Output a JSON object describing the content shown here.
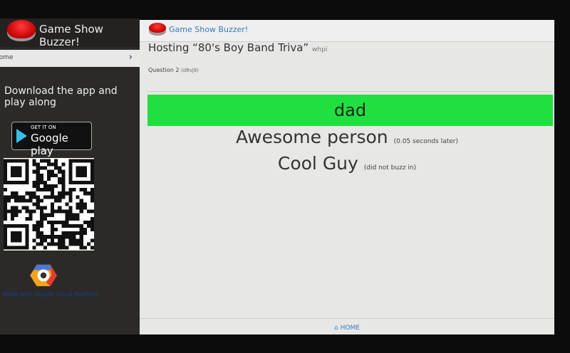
{
  "sidebar": {
    "app_title": "Game Show Buzzer!",
    "nav_home": "Home",
    "nav_chevron": "›",
    "download_text": "Download the app and play along",
    "gplay_small": "GET IT ON",
    "gplay_big": "Google play",
    "cloud_text": "Made with Google Cloud Platform"
  },
  "header": {
    "app_title": "Game Show Buzzer!"
  },
  "game": {
    "hosting": "Hosting “80's Boy Band Triva”",
    "host_code": "whpi",
    "question": "Question 2",
    "question_code": "(d8vj9)"
  },
  "results": [
    {
      "name": "dad",
      "note": ""
    },
    {
      "name": "Awesome person",
      "note": "(0.05 seconds later)"
    },
    {
      "name": "Cool Guy",
      "note": "(did not buzz in)"
    }
  ],
  "footer": {
    "home_icon": "⌂",
    "home_label": "HOME"
  },
  "colors": {
    "winner": "#20e040",
    "accent": "#3a7bbf"
  }
}
